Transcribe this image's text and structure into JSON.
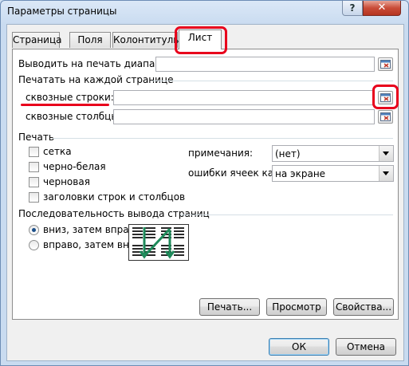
{
  "window": {
    "title": "Параметры страницы",
    "help": "?",
    "close": "✕"
  },
  "tabs": [
    {
      "label": "Страница",
      "active": false
    },
    {
      "label": "Поля",
      "active": false
    },
    {
      "label": "Колонтитулы",
      "active": false
    },
    {
      "label": "Лист",
      "active": true
    }
  ],
  "print_area": {
    "label": "Выводить на печать диапазон:",
    "value": ""
  },
  "print_titles": {
    "group_label": "Печатать на каждой странице",
    "rows_label": "сквозные строки:",
    "rows_value": "",
    "cols_label": "сквозные столбцы:",
    "cols_value": ""
  },
  "print": {
    "group_label": "Печать",
    "gridlines": {
      "label": "сетка",
      "checked": false
    },
    "black_white": {
      "label": "черно-белая",
      "checked": false
    },
    "draft": {
      "label": "черновая",
      "checked": false
    },
    "headings": {
      "label": "заголовки строк и столбцов",
      "checked": false
    },
    "comments_label": "примечания:",
    "comments_value": "(нет)",
    "errors_label": "ошибки ячеек как:",
    "errors_value": "на экране"
  },
  "order": {
    "group_label": "Последовательность вывода страниц",
    "down_then_over": {
      "label": "вниз, затем вправо",
      "selected": true
    },
    "over_then_down": {
      "label": "вправо, затем вниз",
      "selected": false
    }
  },
  "buttons": {
    "print": "Печать...",
    "preview": "Просмотр",
    "options": "Свойства...",
    "ok": "ОК",
    "cancel": "Отмена"
  },
  "colors": {
    "highlight": "#e8001c",
    "accent": "#1b4f8a"
  }
}
